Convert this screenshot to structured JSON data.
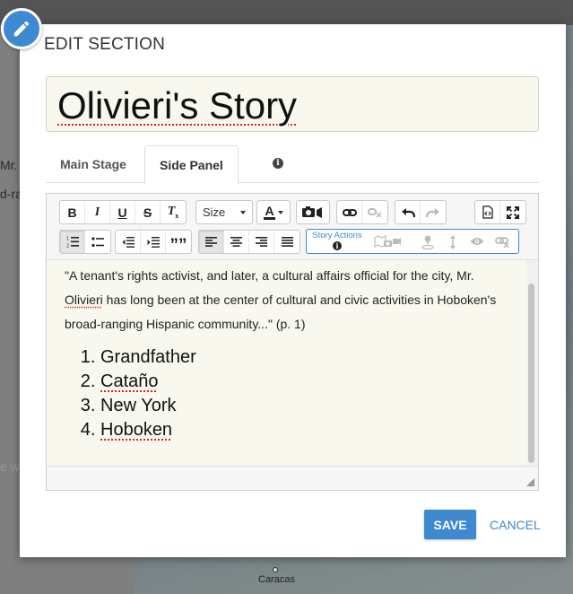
{
  "background": {
    "left_snippets": [
      "Mr.",
      "d-ra"
    ],
    "faint_snippet": "e w",
    "map_label": "Caracas"
  },
  "dialog": {
    "title": "EDIT SECTION",
    "section_title_value": "Olivieri's Story",
    "tabs": [
      {
        "label": "Main Stage",
        "active": false
      },
      {
        "label": "Side Panel",
        "active": true
      }
    ],
    "toolbar": {
      "bold": "B",
      "italic": "I",
      "underline": "U",
      "strike": "S",
      "clear_format": "T",
      "clear_format_sub": "x",
      "size_label": "Size",
      "font_color_label": "A",
      "quote": "””",
      "story_actions_label": "Story Actions"
    },
    "content": {
      "paragraph_before": "\"A tenant's rights activist, and later, a cultural affairs official for the city, Mr. ",
      "paragraph_name": "Olivieri",
      "paragraph_after": " has long been at the center of cultural and civic activities in Hoboken's broad-ranging Hispanic community...\" (p. 1)",
      "list": [
        {
          "text": "Grandfather",
          "misspelled": false
        },
        {
          "text": "Cataño",
          "misspelled": true
        },
        {
          "text": "New York",
          "misspelled": false
        },
        {
          "text": "Hoboken",
          "misspelled": true
        }
      ]
    },
    "save_label": "SAVE",
    "cancel_label": "CANCEL"
  },
  "colors": {
    "accent": "#3d8ad0",
    "title_bg": "#f8f8ef",
    "spellcheck": "#dd2222"
  }
}
